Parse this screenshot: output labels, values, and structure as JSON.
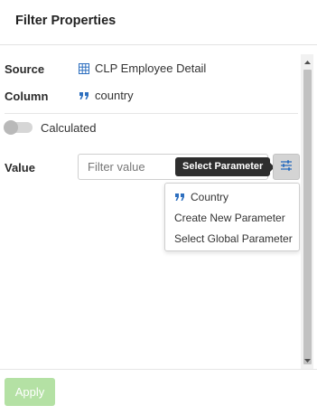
{
  "header": {
    "title": "Filter Properties"
  },
  "source": {
    "label": "Source",
    "value": "CLP Employee Detail",
    "icon": "table-grid-icon"
  },
  "column": {
    "label": "Column",
    "value": "country",
    "icon": "quote-icon"
  },
  "calculated": {
    "label": "Calculated",
    "enabled": false
  },
  "value_row": {
    "label": "Value",
    "placeholder": "Filter value",
    "input_value": "",
    "tooltip": "Select Parameter",
    "button_icon": "sliders-icon"
  },
  "param_menu": {
    "items": [
      {
        "label": "Country",
        "icon": "quote-icon"
      },
      {
        "label": "Create New Parameter"
      },
      {
        "label": "Select Global Parameter"
      }
    ]
  },
  "footer": {
    "apply_label": "Apply"
  },
  "colors": {
    "icon_blue": "#2d6fbf",
    "apply_green": "#b4e1a4",
    "tooltip_bg": "#2e2e2e"
  }
}
